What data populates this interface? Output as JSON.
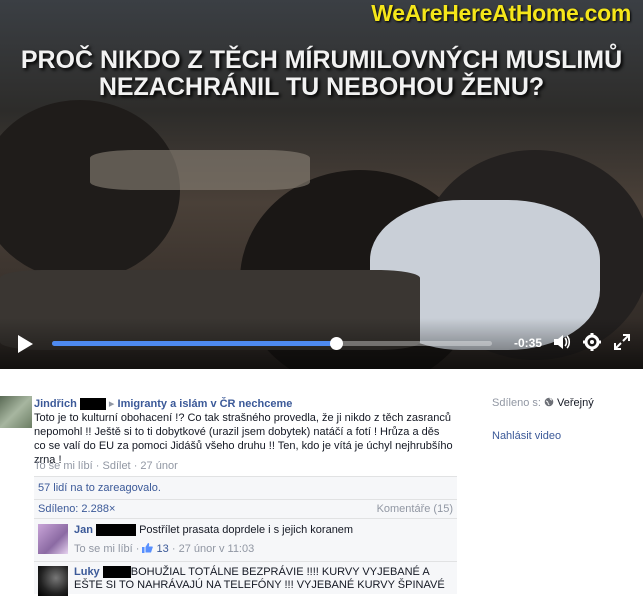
{
  "video": {
    "watermark": "WeAreHereAtHome.com",
    "headline_line1": "PROČ NIKDO Z TĚCH MÍRUMILOVNÝCH MUSLIMŮ",
    "headline_line2": "NEZACHRÁNIL TU NEBOHOU ŽENU?",
    "time_remaining": "-0:35",
    "progress_fraction": 0.645
  },
  "post": {
    "author": "Jindřich",
    "arrow": "▸",
    "group": "Imigranty a islám v ČR nechceme",
    "text": "Toto je to kulturní obohacení !? Co tak strašného provedla, že ji nikdo z těch zasranců nepomohl !! Ještě si to ti dobytkové (urazil jsem dobytek) natáčí a fotí ! Hrůza a děs co se valí do EU za pomoci Jidášů všeho druhu !! Ten, kdo je vítá je úchyl nejhrubšího zrna !",
    "like": "To se mi líbí",
    "dot": "·",
    "share": "Sdílet",
    "date": "27 únor"
  },
  "sidebar": {
    "shared_label": "Sdíleno s:",
    "audience": "Veřejný",
    "report": "Nahlásit video"
  },
  "reactions": {
    "count_text": "57 lidí na to zareagovalo.",
    "shared_count": "Sdíleno: 2.288×",
    "comments_count": "Komentáře (15)"
  },
  "comments": [
    {
      "author": "Jan",
      "text": "Postřílet prasata doprdele i s jejich koranem",
      "like": "To se mi líbí",
      "likes": "13",
      "date": "27 únor v 11:03"
    },
    {
      "author": "Luky",
      "text": "BOHUŽIAL TOTÁLNE BEZPRÁVIE !!!! KURVY VYJEBANÉ A ",
      "text2": "EŠTE SI TO NAHRÁVAJÚ NA TELEFÓNY !!! VYJEBANÉ KURVY ŠPINAVÉ"
    }
  ],
  "icons": [
    "play-icon",
    "volume-icon",
    "settings-icon",
    "fullscreen-icon",
    "globe-icon",
    "thumbs-up-icon"
  ]
}
